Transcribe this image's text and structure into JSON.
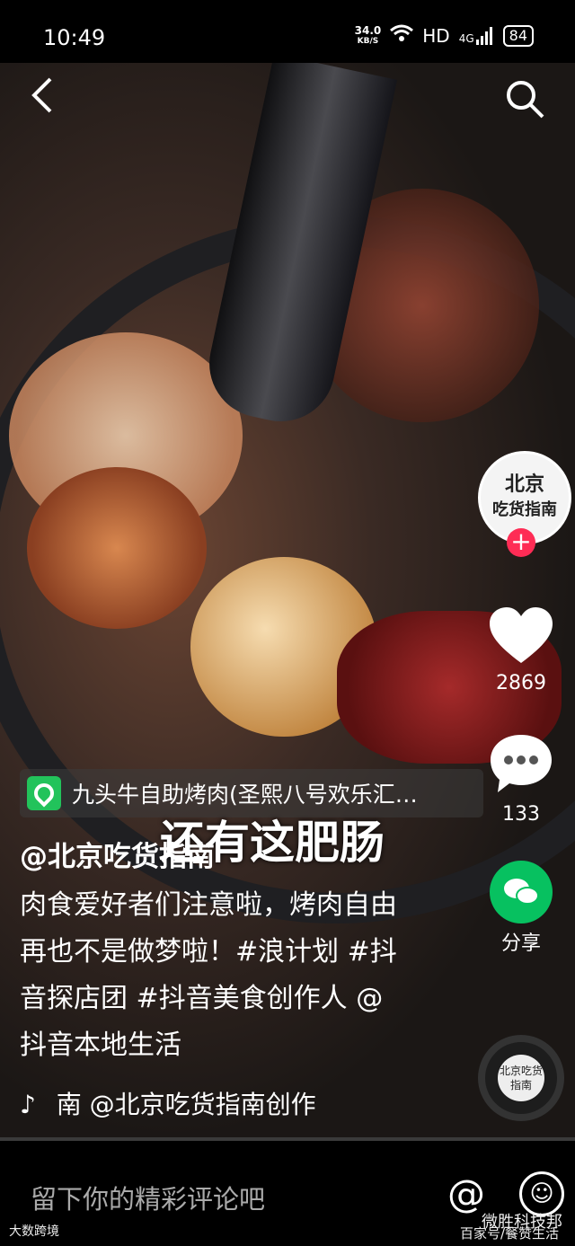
{
  "status_bar": {
    "time": "10:49",
    "speed_value": "34.0",
    "speed_unit": "KB/S",
    "hd": "HD",
    "network": "4G",
    "battery": "84"
  },
  "nav": {
    "back_icon": "back-arrow-icon",
    "search_icon": "search-icon"
  },
  "creator": {
    "avatar_line1": "北京",
    "avatar_line2": "吃货指南",
    "follow_symbol": "+"
  },
  "actions": {
    "likes": "2869",
    "comments": "133",
    "share_label": "分享"
  },
  "location": {
    "text": "九头牛自助烤肉(圣熙八号欢乐汇…"
  },
  "caption_overlay": "还有这肥肠",
  "post": {
    "author": "@北京吃货指南",
    "description": "肉食爱好者们注意啦，烤肉自由再也不是做梦啦！#浪计划 #抖音探店团 #抖音美食创作人 @抖音本地生活"
  },
  "music": {
    "note_symbol": "♪",
    "text": "南    @北京吃货指南创作"
  },
  "disc": {
    "label": "北京吃货指南"
  },
  "comment_bar": {
    "placeholder": "留下你的精彩评论吧",
    "at_symbol": "@",
    "emoji_symbol": "☺"
  },
  "watermarks": {
    "left": "大数跨境",
    "right_line1": "微胜科技邦",
    "right_line2": "百家号/餐赞生活"
  },
  "colors": {
    "follow": "#fe2c55",
    "location_pin": "#22c35b",
    "wechat": "#07c160"
  }
}
